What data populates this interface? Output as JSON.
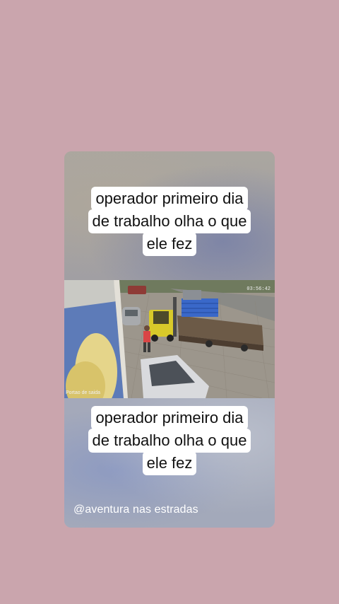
{
  "caption_top": {
    "lines": [
      "operador primeiro dia",
      "de trabalho olha o que",
      "ele fez"
    ]
  },
  "caption_bottom": {
    "lines": [
      "operador primeiro dia",
      "de trabalho olha o que",
      "ele fez"
    ]
  },
  "video": {
    "timestamp": "03:56:42",
    "camera_label": "Portao de saida"
  },
  "handle": "@aventura nas estradas",
  "colors": {
    "page_background": "#caa5ad",
    "caption_background": "#ffffff",
    "caption_text": "#111111",
    "handle_text": "#ffffff"
  }
}
